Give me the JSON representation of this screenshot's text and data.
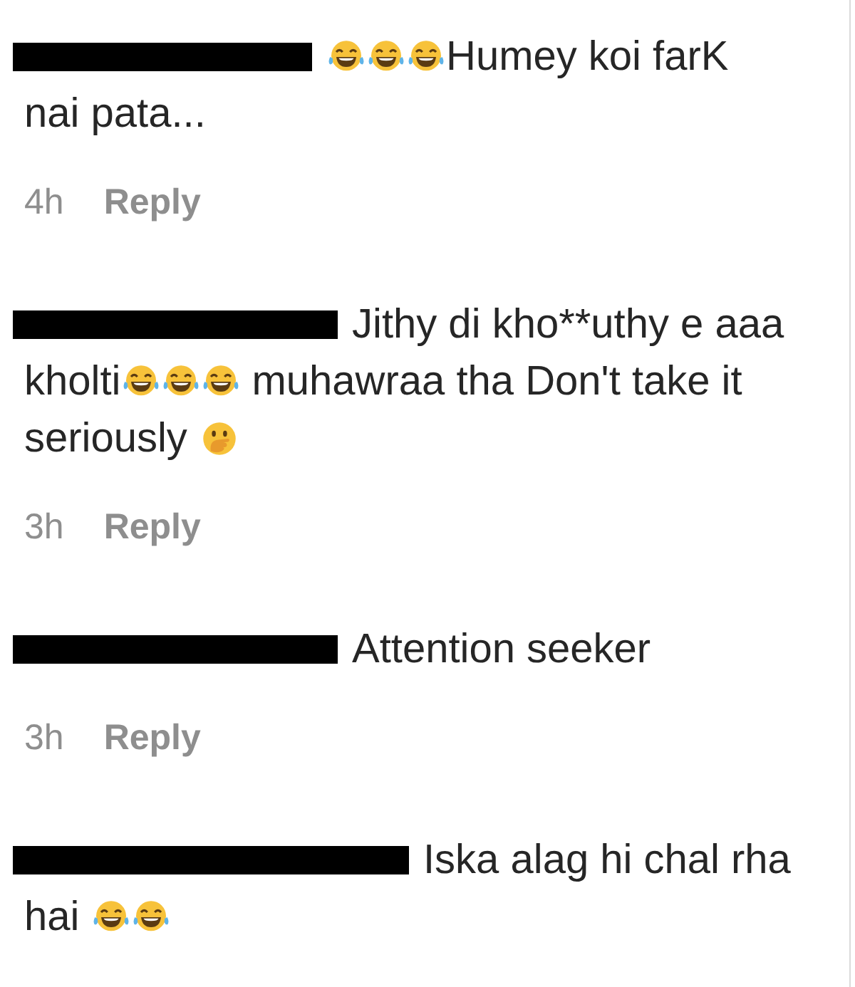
{
  "comments": [
    {
      "lines": [
        [
          {
            "kind": "laugh"
          },
          {
            "kind": "laugh"
          },
          {
            "kind": "laugh"
          },
          {
            "kind": "text",
            "text": "Humey koi farK"
          }
        ],
        [
          {
            "kind": "text",
            "text": "nai pata..."
          }
        ]
      ],
      "time": "4h",
      "reply": "Reply"
    },
    {
      "lines": [
        [
          {
            "kind": "text",
            "text": "Jithy di kho**uthy e aaa"
          }
        ],
        [
          {
            "kind": "text",
            "text": "kholti"
          },
          {
            "kind": "laugh"
          },
          {
            "kind": "laugh"
          },
          {
            "kind": "laugh"
          },
          {
            "kind": "text",
            "text": " muhawraa tha Don't take it"
          }
        ],
        [
          {
            "kind": "text",
            "text": "seriously "
          },
          {
            "kind": "hush"
          }
        ]
      ],
      "time": "3h",
      "reply": "Reply"
    },
    {
      "lines": [
        [
          {
            "kind": "text",
            "text": "Attention seeker"
          }
        ]
      ],
      "time": "3h",
      "reply": "Reply"
    },
    {
      "lines": [
        [
          {
            "kind": "text",
            "text": "Iska alag hi chal rha"
          }
        ],
        [
          {
            "kind": "text",
            "text": "hai "
          },
          {
            "kind": "laugh"
          },
          {
            "kind": "laugh"
          }
        ]
      ]
    }
  ]
}
